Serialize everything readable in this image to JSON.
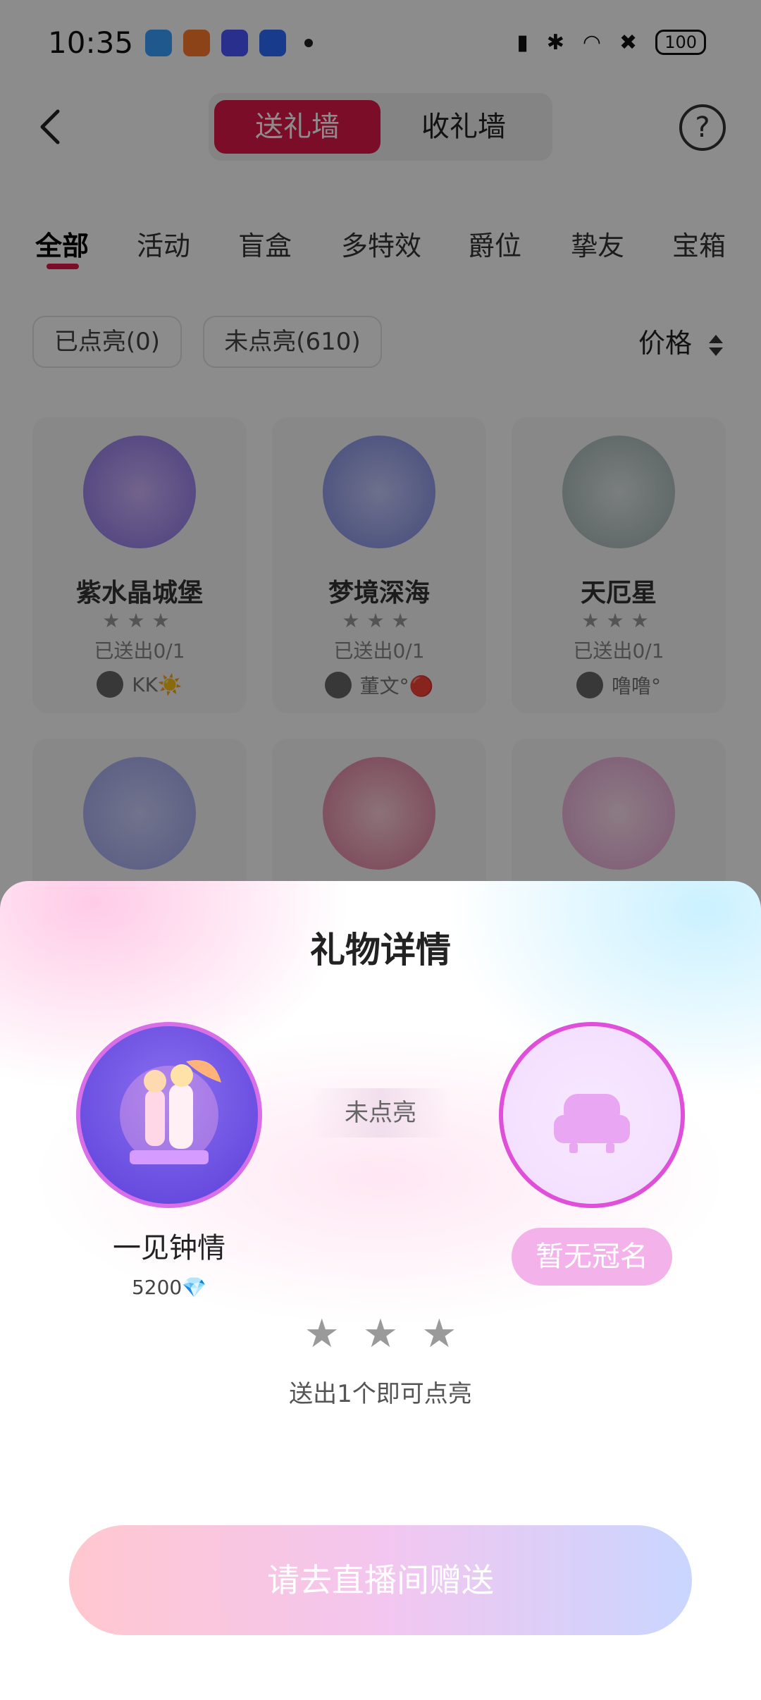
{
  "status_bar": {
    "time": "10:35",
    "battery": "100",
    "app_icons": [
      "app-icon-1",
      "app-icon-2",
      "app-icon-3",
      "app-icon-4"
    ]
  },
  "header": {
    "tabs": [
      {
        "label": "送礼墙",
        "active": true
      },
      {
        "label": "收礼墙",
        "active": false
      }
    ],
    "help_icon": "?"
  },
  "categories": {
    "items": [
      "全部",
      "活动",
      "盲盒",
      "多特效",
      "爵位",
      "挚友",
      "宝箱"
    ],
    "active_index": 0
  },
  "filters": {
    "lit": "已点亮(0)",
    "unlit": "未点亮(610)",
    "sort": "价格"
  },
  "cards": [
    {
      "name": "紫水晶城堡",
      "stars": "★★★",
      "count": "已送出0/1",
      "user": "KK☀️"
    },
    {
      "name": "梦境深海",
      "stars": "★★★",
      "count": "已送出0/1",
      "user": "董文°🔴"
    },
    {
      "name": "天厄星",
      "stars": "★★★",
      "count": "已送出0/1",
      "user": "噜噜°"
    }
  ],
  "sheet": {
    "title": "礼物详情",
    "gift_name": "一见钟情",
    "price": "5200💎",
    "status": "未点亮",
    "naming": "暂无冠名",
    "stars": "★★★",
    "hint": "送出1个即可点亮",
    "cta": "请去直播间赠送"
  },
  "colors": {
    "accent": "#e0194b",
    "cta_gradient": [
      "#ffc7cf",
      "#f3c6ef",
      "#c9d6ff"
    ],
    "naming_pill": "#f3b3ea"
  }
}
